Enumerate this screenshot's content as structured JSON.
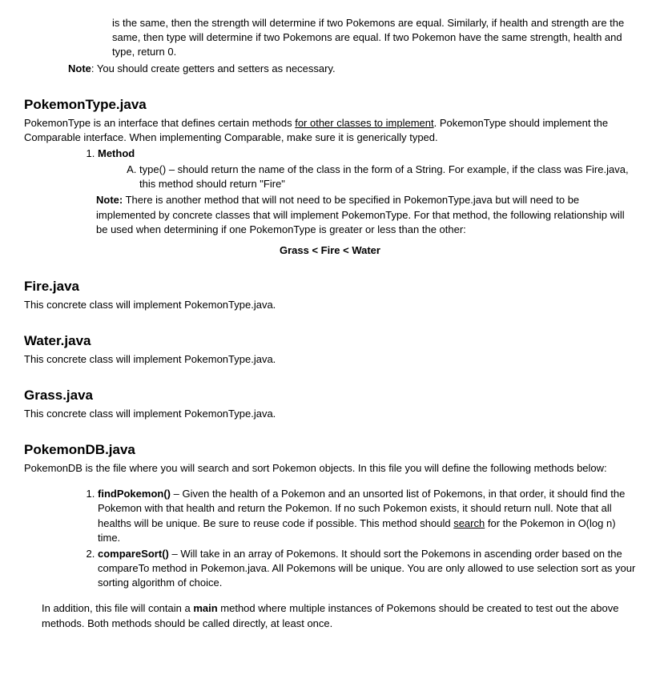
{
  "top_continuation": "is the same, then the strength will determine if two Pokemons are equal. Similarly, if health and strength are the same, then type will determine if two Pokemons are equal. If two Pokemon have the same strength, health and type, return 0.",
  "top_note_label": "Note",
  "top_note_text": ": You should create getters and setters as necessary.",
  "pokemon_type": {
    "heading": "PokemonType.java",
    "intro_pre": "PokemonType is an interface that defines certain methods ",
    "intro_underlined": "for other classes to implement",
    "intro_post": ". PokemonType should implement the Comparable interface. When implementing Comparable, make sure it is generically typed.",
    "list_label": "Method",
    "method_text": "type() – should return the name of the class in the form of a String. For example, if the class was Fire.java, this method should return \"Fire\"",
    "note_label": "Note:",
    "note_text": " There is another method that will not need to be specified in PokemonType.java but will need to be implemented by concrete classes that will implement PokemonType. For that method, the following relationship will be used when determining if one PokemonType is greater or less than the other:",
    "ordering": "Grass < Fire < Water"
  },
  "fire": {
    "heading": "Fire.java",
    "text": "This concrete class will implement PokemonType.java."
  },
  "water": {
    "heading": "Water.java",
    "text": "This concrete class will implement PokemonType.java."
  },
  "grass": {
    "heading": "Grass.java",
    "text": "This concrete class will implement PokemonType.java."
  },
  "db": {
    "heading": "PokemonDB.java",
    "intro": "PokemonDB is the file where you will search and sort Pokemon objects. In this file you will define the following methods below:",
    "m1_name": "findPokemon()",
    "m1_pre": " – Given the health of a Pokemon and an unsorted list of Pokemons, in that order, it should find the Pokemon with that health and return the Pokemon. If no such Pokemon exists, it should return null. Note that all healths will be unique. Be sure to reuse code if possible. This method should ",
    "m1_u": "search",
    "m1_post": " for the Pokemon in O(log n) time.",
    "m2_name": "compareSort()",
    "m2_text": " – Will take in an array of Pokemons. It should sort the Pokemons in ascending order based on the compareTo method in Pokemon.java. All Pokemons will be unique. You are only allowed to use selection sort as your sorting algorithm of choice.",
    "addendum_pre": "In addition, this file will contain a ",
    "addendum_bold": "main",
    "addendum_post": " method where multiple instances of Pokemons should be created to test out the above methods. Both methods should be called directly, at least once."
  }
}
